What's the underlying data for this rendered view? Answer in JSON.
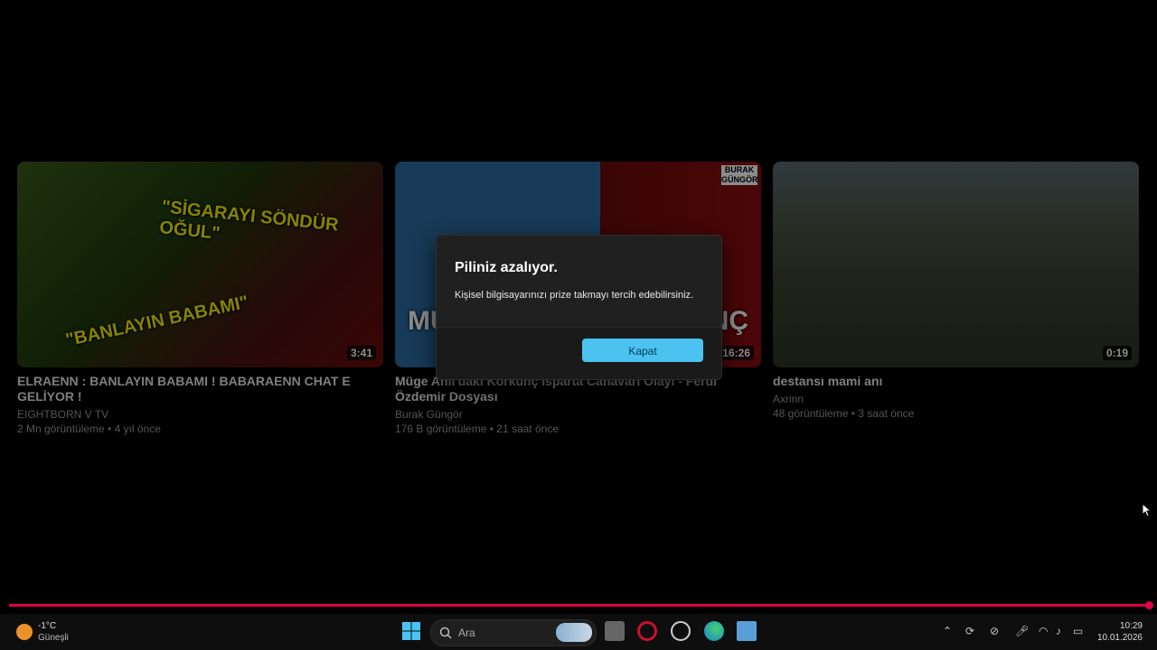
{
  "videos": [
    {
      "thumb_text_1": "\"SİGARAYI SÖNDÜR OĞUL\"",
      "thumb_text_2": "\"BANLAYIN BABAMI\"",
      "duration": "3:41",
      "title": "ELRAENN : BANLAYIN BABAMI ! BABARAENN CHAT E GELİYOR !",
      "channel": "EIGHTBORN V TV",
      "meta": "2 Mn görüntüleme • 4 yıl önce"
    },
    {
      "thumb_left": "MÜ",
      "thumb_right": "NÇ",
      "thumb_logo": "BURAK GÜNGÖR",
      "duration": "16:26",
      "title": "Müge Anlı'daki Korkunç Isparta Canavarı Olayı - Ferdi Özdemir Dosyası",
      "channel": "Burak Güngör",
      "meta": "176 B görüntüleme • 21 saat önce"
    },
    {
      "duration": "0:19",
      "title": "destansı mami anı",
      "channel": "Axrinn",
      "meta": "48 görüntüleme • 3 saat önce"
    }
  ],
  "player": {
    "progress_percent": 100
  },
  "dialog": {
    "title": "Piliniz azalıyor.",
    "message": "Kişisel bilgisayarınızı prize takmayı tercih edebilirsiniz.",
    "button": "Kapat"
  },
  "taskbar": {
    "weather_temp": "-1°C",
    "weather_desc": "Güneşli",
    "search_placeholder": "Ara",
    "time": "10:29",
    "date": "10.01.2026"
  },
  "colors": {
    "accent": "#4cc2f1",
    "progress": "#e0004a"
  }
}
